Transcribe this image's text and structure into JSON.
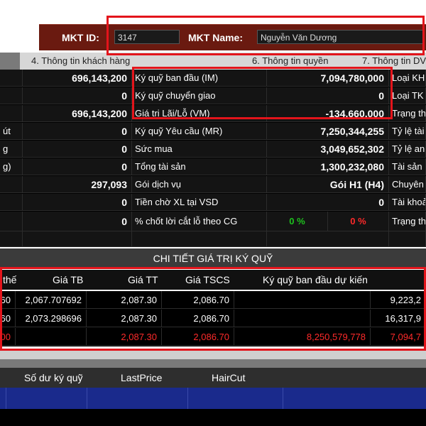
{
  "header": {
    "mkt_id_label": "MKT ID:",
    "mkt_id_value": "3147",
    "mkt_name_label": "MKT Name:",
    "mkt_name_value": "Nguyễn Văn Dương"
  },
  "tabs": [
    {
      "label": "4. Thông tin khách hàng"
    },
    {
      "label": "6. Thông tin quyền"
    },
    {
      "label": "7. Thông tin DV"
    }
  ],
  "rows": [
    {
      "c0": "",
      "c1": "696,143,200",
      "c2": "Ký quỹ ban đầu (IM)",
      "c3": "7,094,780,000",
      "c4": "Loại KH"
    },
    {
      "c0": "",
      "c1": "0",
      "c2": "Ký quỹ chuyển giao",
      "c3": "0",
      "c4": "Loại TK"
    },
    {
      "c0": "",
      "c1": "696,143,200",
      "c2": "Giá trị Lãi/Lỗ (VM)",
      "c3": "-134,660,000",
      "c4": "Trạng th"
    },
    {
      "c0": "út",
      "c1": "0",
      "c2": "Ký quỹ Yêu cầu (MR)",
      "c3": "7,250,344,255",
      "c4": "Tỷ lệ tài"
    },
    {
      "c0": "g",
      "c1": "0",
      "c2": "Sức mua",
      "c3": "3,049,652,302",
      "c4": "Tỷ lệ an"
    },
    {
      "c0": "g)",
      "c1": "0",
      "c2": "Tổng tài sản",
      "c3": "1,300,232,080",
      "c4": "Tài sản"
    },
    {
      "c0": "",
      "c1": "297,093",
      "c2": "Gói dịch vụ",
      "c3": "Gói H1 (H4)",
      "c4": "Chuyên"
    },
    {
      "c0": "",
      "c1": "0",
      "c2": "Tiền chờ XL tại VSD",
      "c3": "0",
      "c4": "Tài khoả"
    },
    {
      "c0": "",
      "c1": "0",
      "c2": "% chốt lời cắt lỗ theo CG",
      "c3a": "0 %",
      "c3b": "0 %",
      "c4": "Trạng th"
    }
  ],
  "detail": {
    "title": "CHI TIẾT GIÁ TRỊ KÝ QUỸ",
    "columns": [
      "thế",
      "Giá TB",
      "Giá TT",
      "Giá TSCS",
      "Ký quỹ ban đầu dự kiến"
    ],
    "rows": [
      {
        "a": "60",
        "b": "2,067.707692",
        "c": "2,087.30",
        "d": "2,086.70",
        "e": "",
        "f": "9,223,2"
      },
      {
        "a": "60",
        "b": "2,073.298696",
        "c": "2,087.30",
        "d": "2,086.70",
        "e": "",
        "f": "16,317,9"
      },
      {
        "a": "00",
        "b": "",
        "c": "2,087.30",
        "d": "2,086.70",
        "e": "8,250,579,778",
        "f": "7,094,7"
      }
    ]
  },
  "bottom": {
    "columns": [
      "Số dư ký quỹ",
      "LastPrice",
      "HairCut"
    ]
  },
  "colors": {
    "highlight": "#e3141b",
    "positive": "#1ec21e",
    "negative": "#ff2a2a",
    "header_bar": "#6a1a10",
    "selected_row": "#1a2a8c"
  }
}
